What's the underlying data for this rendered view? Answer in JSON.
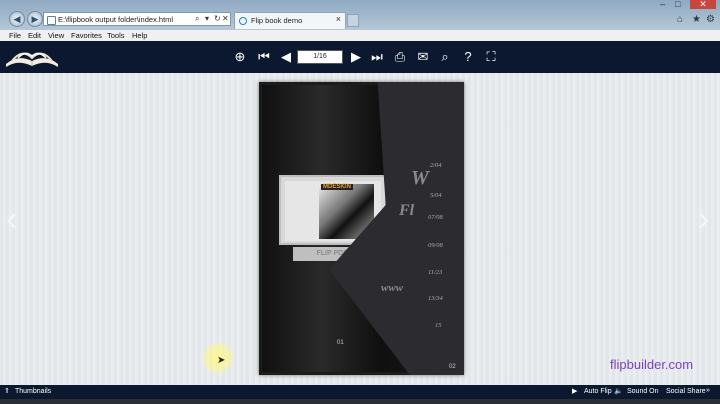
{
  "browser": {
    "address": "E:\\flipbook output folder\\index.html",
    "tab_title": "Flip book demo",
    "menu": [
      "File",
      "Edit",
      "View",
      "Favorites",
      "Tools",
      "Help"
    ]
  },
  "toolbar": {
    "page_indicator": "1/16",
    "buttons": [
      "zoom-in",
      "first-page",
      "previous-page",
      "next-page",
      "last-page",
      "print",
      "email",
      "search",
      "help",
      "fullscreen"
    ]
  },
  "book": {
    "thumbnail_label": "MDESIGN",
    "monitor_label": "FLIP PDF",
    "curl_text_1": "W",
    "curl_text_2": "Fl",
    "curl_text_3": "www",
    "dates": [
      "2/04",
      "5/04",
      "07/08",
      "09/08",
      "11/23",
      "13/34",
      "15"
    ],
    "left_page_number": "01",
    "right_page_number": "02"
  },
  "watermark": "flipbuilder.com",
  "bottom": {
    "thumbnails_label": "Thumbnails",
    "auto_flip_label": "Auto Flip",
    "sound_label": "Sound On",
    "share_label": "Social Share"
  }
}
